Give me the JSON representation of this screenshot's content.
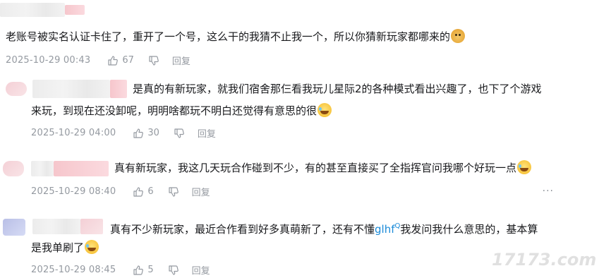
{
  "comments": [
    {
      "text_lines": [
        "老账号被实名认证卡住了，重开了一个号，这么干的我猜不止我一个，所以你猜新玩家都哪来的"
      ],
      "emoji": "doge",
      "date": "2025-10-29 00:43",
      "likes": "67",
      "reply_label": "回复"
    },
    {
      "text_lines": [
        "是真的有新玩家，就我们宿舍那仨看我玩儿星际2的各种模式看出兴趣了，也下了个游戏",
        "来玩，到现在还没卸呢，明明啥都玩不明白还觉得有意思的很"
      ],
      "emoji": "laugh",
      "date": "2025-10-29 04:00",
      "likes": "30",
      "reply_label": "回复"
    },
    {
      "text_lines": [
        "真有新玩家，我这几天玩合作碰到不少，有的甚至直接买了全指挥官问我哪个好玩一点"
      ],
      "emoji": "laugh",
      "date": "2025-10-29 08:40",
      "likes": "6",
      "reply_label": "回复"
    },
    {
      "text_lines": [
        "真有不少新玩家，最近合作看到好多真萌新了，还有不懂",
        "我发问我什么意思的，基本算",
        "是我单刷了"
      ],
      "link_text": "glhf",
      "link_mark": "Q",
      "emoji": "laugh",
      "date": "2025-10-29 08:45",
      "likes": "5",
      "reply_label": "回复"
    }
  ],
  "more_label": "···",
  "watermark": "17173.com",
  "colors": {
    "text": "#18191c",
    "meta": "#9499a0",
    "link": "#1b8bd9",
    "background": "#ffffff"
  },
  "icons": {
    "like": "thumbs-up-icon",
    "dislike": "thumbs-down-icon",
    "more": "more-icon"
  }
}
